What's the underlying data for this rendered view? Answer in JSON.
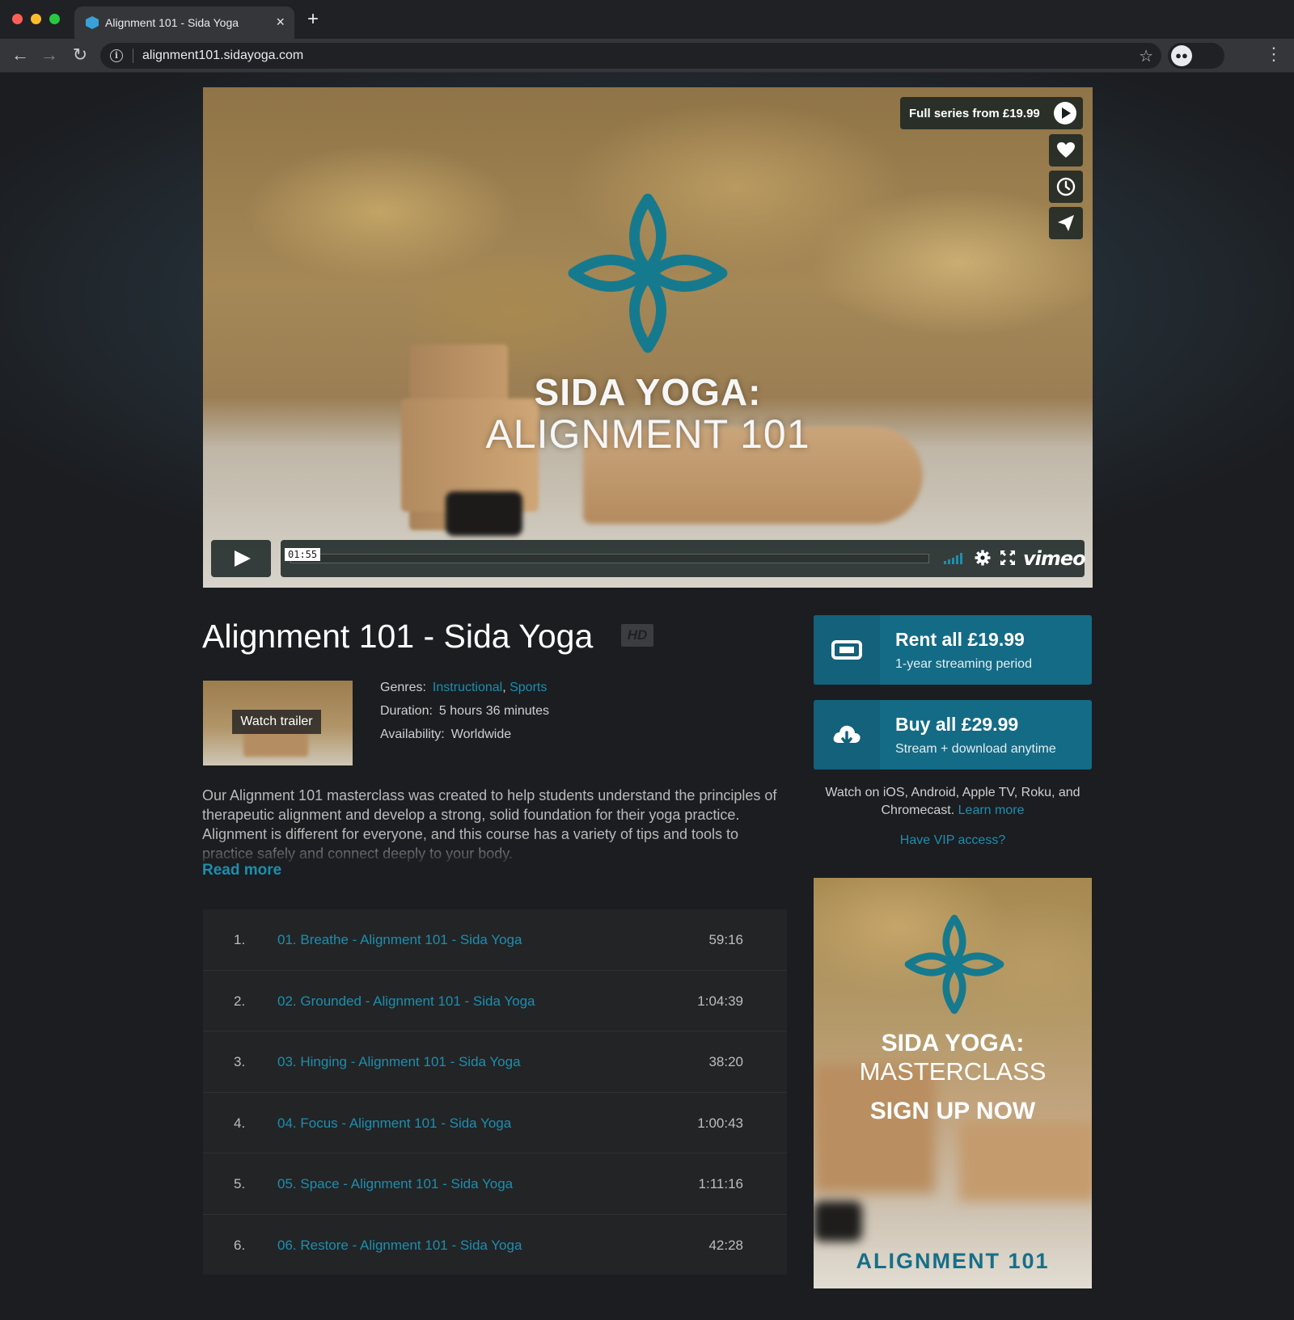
{
  "browser": {
    "tab_title": "Alignment 101 - Sida Yoga",
    "tab_close": "×",
    "new_tab": "+",
    "url": "alignment101.sidayoga.com"
  },
  "player": {
    "title_line1": "SIDA YOGA:",
    "title_line2": "ALIGNMENT 101",
    "full_series_label": "Full series from £19.99",
    "timestamp": "01:55",
    "brand": "vimeo",
    "icons": [
      "heart-icon",
      "clock-icon",
      "share-icon",
      "play-icon",
      "volume-icon",
      "gear-icon",
      "fullscreen-icon"
    ]
  },
  "video": {
    "title": "Alignment 101 - Sida Yoga",
    "quality_badge": "HD",
    "trailer_label": "Watch trailer",
    "genres_label": "Genres:",
    "genres": [
      "Instructional",
      "Sports"
    ],
    "genre_sep": ",",
    "duration_label": "Duration:",
    "duration": "5 hours 36 minutes",
    "availability_label": "Availability:",
    "availability": "Worldwide",
    "description": "Our Alignment 101 masterclass was created to help students understand the principles of therapeutic alignment and develop a strong, solid foundation for their yoga practice. Alignment is different for everyone, and this course has a variety of tips and tools to practice safely and connect deeply to your body.",
    "read_more": "Read more"
  },
  "episodes": [
    {
      "num": "1.",
      "title": "01. Breathe - Alignment 101 - Sida Yoga",
      "duration": "59:16"
    },
    {
      "num": "2.",
      "title": "02. Grounded - Alignment 101 - Sida Yoga",
      "duration": "1:04:39"
    },
    {
      "num": "3.",
      "title": "03. Hinging - Alignment 101 - Sida Yoga",
      "duration": "38:20"
    },
    {
      "num": "4.",
      "title": "04. Focus - Alignment 101 - Sida Yoga",
      "duration": "1:00:43"
    },
    {
      "num": "5.",
      "title": "05. Space - Alignment 101 - Sida Yoga",
      "duration": "1:11:16"
    },
    {
      "num": "6.",
      "title": "06. Restore - Alignment 101 - Sida Yoga",
      "duration": "42:28"
    }
  ],
  "purchase": {
    "rent_label": "Rent all £19.99",
    "rent_sub": "1-year streaming period",
    "buy_label": "Buy all £29.99",
    "buy_sub": "Stream + download anytime",
    "platforms_text": "Watch on iOS, Android, Apple TV, Roku, and Chromecast.",
    "learn_more": "Learn more",
    "vip": "Have VIP access?"
  },
  "promo": {
    "line1": "SIDA YOGA:",
    "line2": "MASTERCLASS",
    "line3": "SIGN UP NOW",
    "line4": "ALIGNMENT 101"
  },
  "colors": {
    "accent": "#1b8fb0",
    "cta": "#146b86",
    "logo_teal": "#167a8e"
  }
}
